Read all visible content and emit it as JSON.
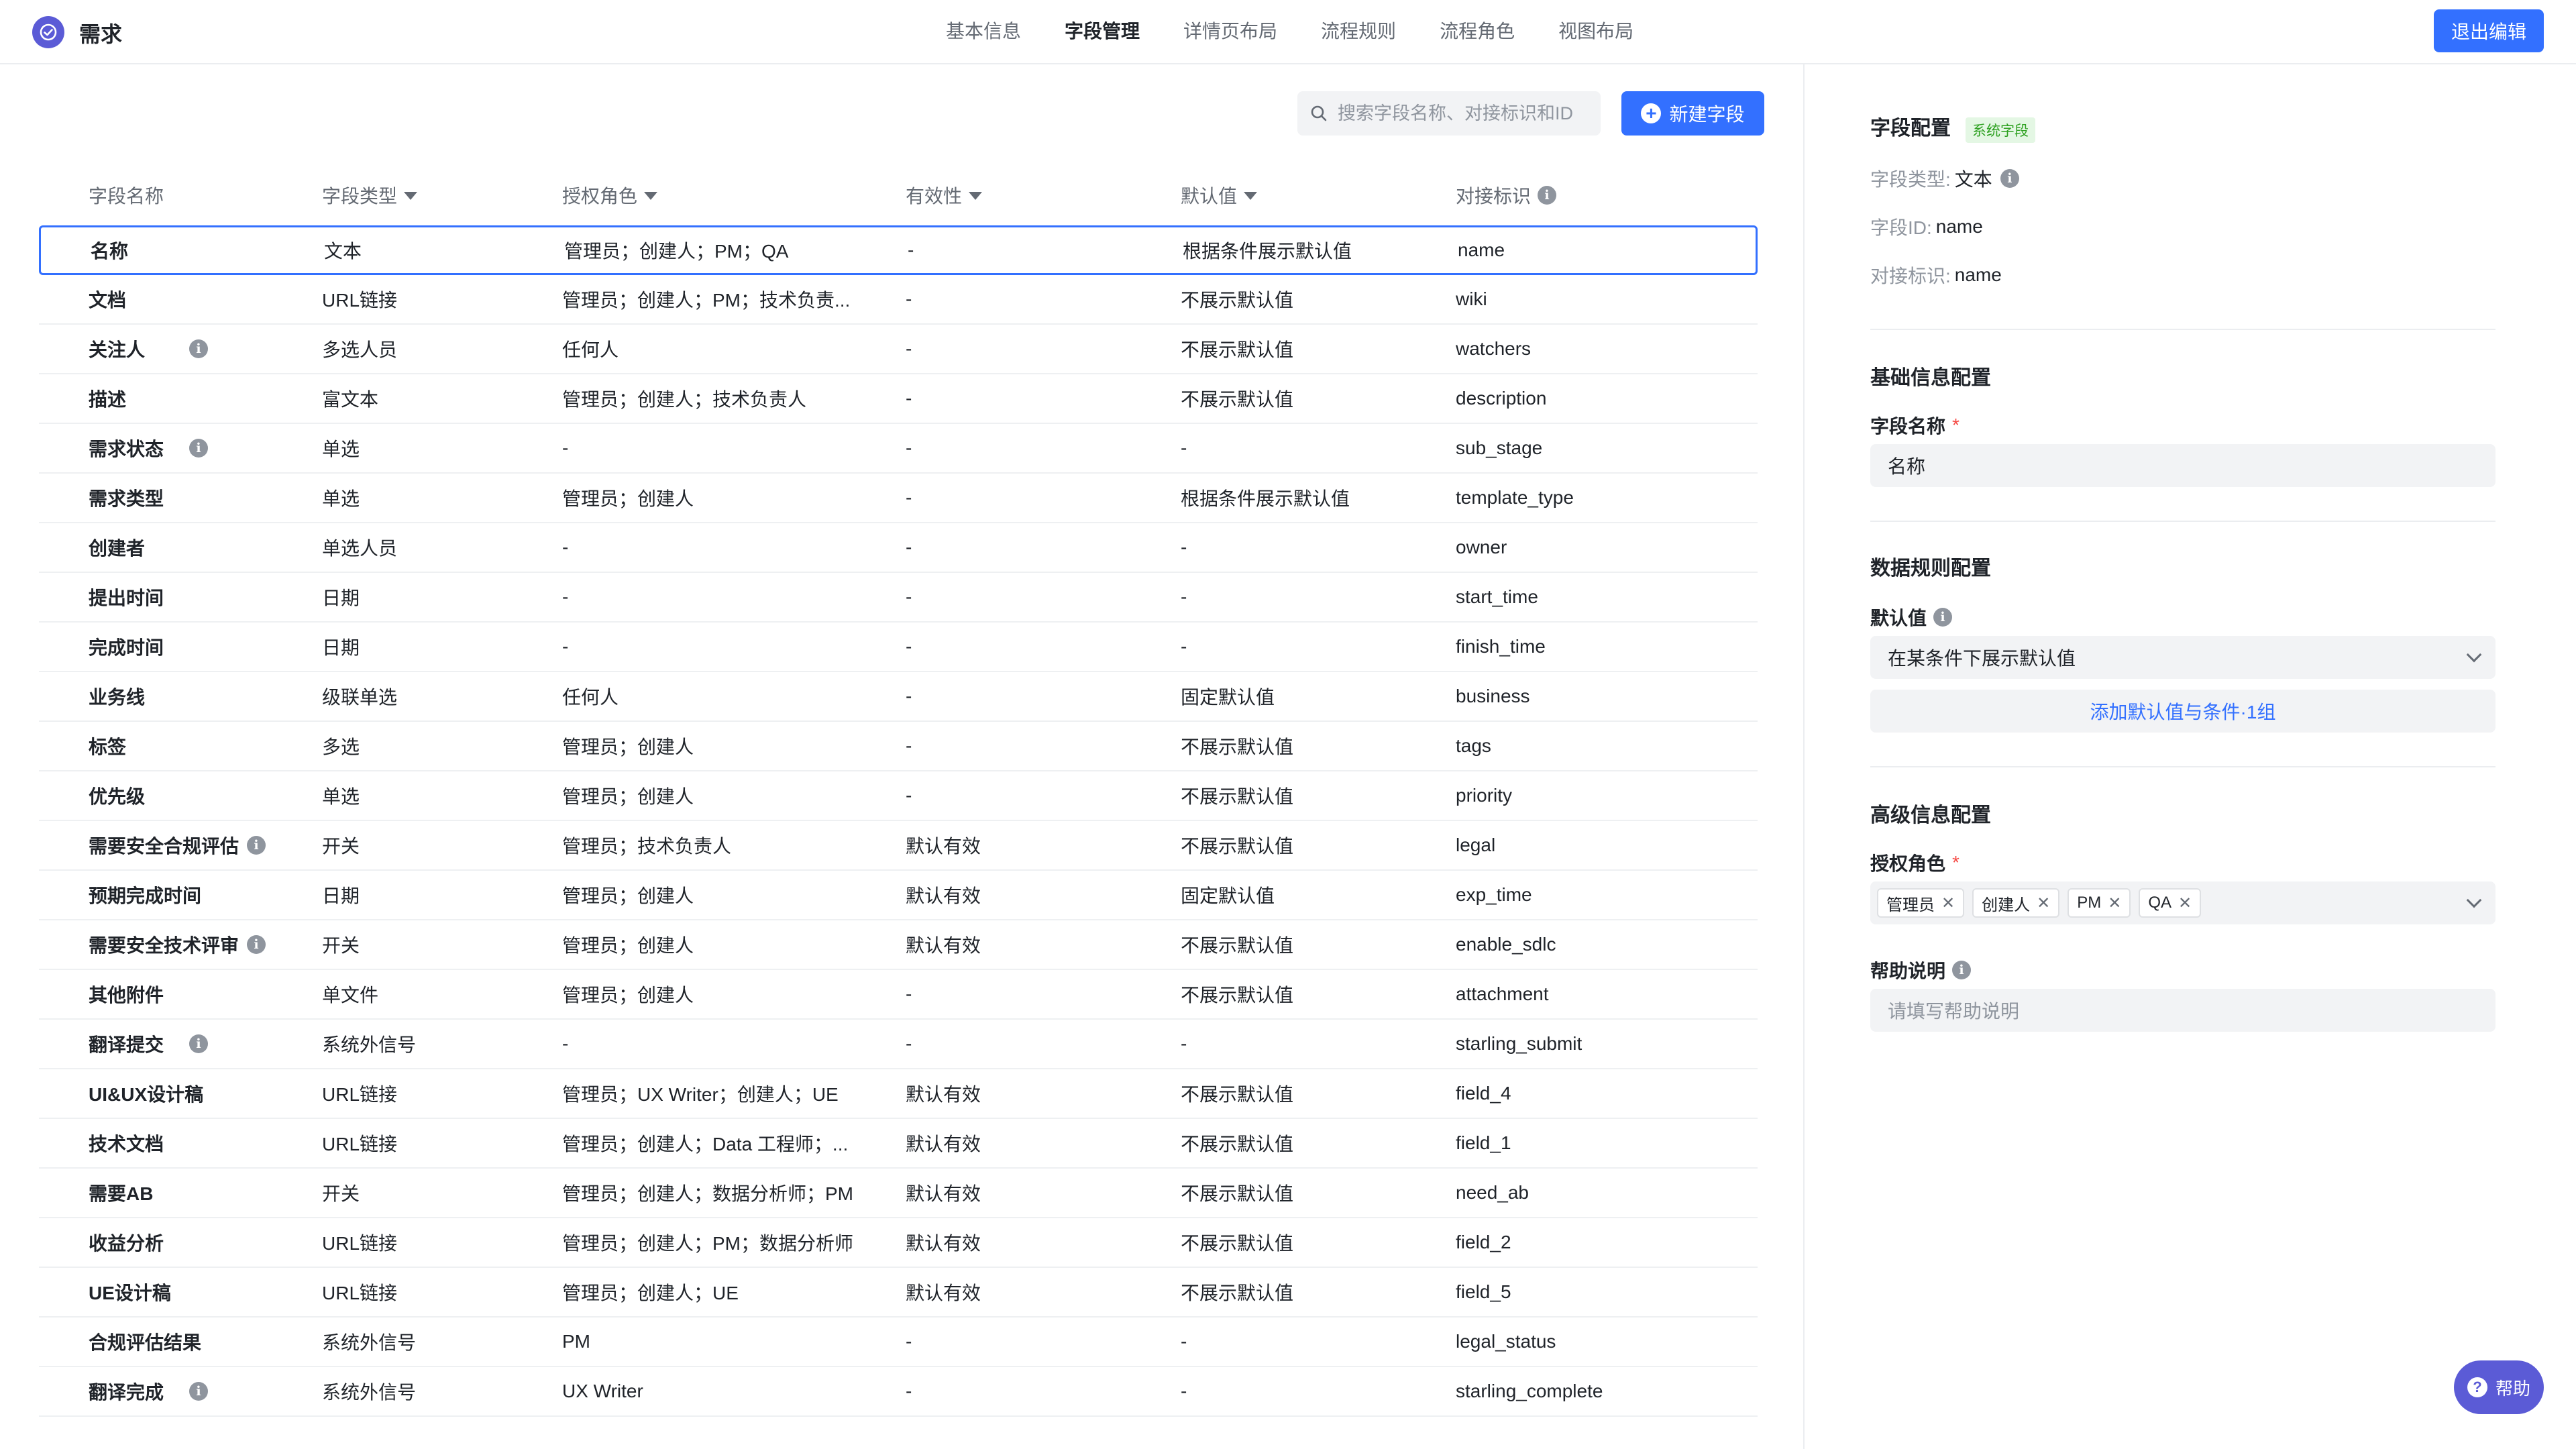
{
  "app": {
    "title": "需求"
  },
  "tabs": [
    "基本信息",
    "字段管理",
    "详情页布局",
    "流程规则",
    "流程角色",
    "视图布局"
  ],
  "header": {
    "exit_label": "退出编辑"
  },
  "toolbar": {
    "search_placeholder": "搜索字段名称、对接标识和ID",
    "new_field_label": "新建字段"
  },
  "table": {
    "columns": [
      "字段名称",
      "字段类型",
      "授权角色",
      "有效性",
      "默认值",
      "对接标识"
    ],
    "rows": [
      {
        "name": "名称",
        "type": "文本",
        "roles": "管理员；创建人；PM；QA",
        "validity": "-",
        "default": "根据条件展示默认值",
        "key": "name",
        "info": false
      },
      {
        "name": "文档",
        "type": "URL链接",
        "roles": "管理员；创建人；PM；技术负责...",
        "validity": "-",
        "default": "不展示默认值",
        "key": "wiki",
        "info": false
      },
      {
        "name": "关注人",
        "type": "多选人员",
        "roles": "任何人",
        "validity": "-",
        "default": "不展示默认值",
        "key": "watchers",
        "info": true
      },
      {
        "name": "描述",
        "type": "富文本",
        "roles": "管理员；创建人；技术负责人",
        "validity": "-",
        "default": "不展示默认值",
        "key": "description",
        "info": false
      },
      {
        "name": "需求状态",
        "type": "单选",
        "roles": "-",
        "validity": "-",
        "default": "-",
        "key": "sub_stage",
        "info": true
      },
      {
        "name": "需求类型",
        "type": "单选",
        "roles": "管理员；创建人",
        "validity": "-",
        "default": "根据条件展示默认值",
        "key": "template_type",
        "info": false
      },
      {
        "name": "创建者",
        "type": "单选人员",
        "roles": "-",
        "validity": "-",
        "default": "-",
        "key": "owner",
        "info": false
      },
      {
        "name": "提出时间",
        "type": "日期",
        "roles": "-",
        "validity": "-",
        "default": "-",
        "key": "start_time",
        "info": false
      },
      {
        "name": "完成时间",
        "type": "日期",
        "roles": "-",
        "validity": "-",
        "default": "-",
        "key": "finish_time",
        "info": false
      },
      {
        "name": "业务线",
        "type": "级联单选",
        "roles": "任何人",
        "validity": "-",
        "default": "固定默认值",
        "key": "business",
        "info": false
      },
      {
        "name": "标签",
        "type": "多选",
        "roles": "管理员；创建人",
        "validity": "-",
        "default": "不展示默认值",
        "key": "tags",
        "info": false
      },
      {
        "name": "优先级",
        "type": "单选",
        "roles": "管理员；创建人",
        "validity": "-",
        "default": "不展示默认值",
        "key": "priority",
        "info": false
      },
      {
        "name": "需要安全合规评估",
        "type": "开关",
        "roles": "管理员；技术负责人",
        "validity": "默认有效",
        "default": "不展示默认值",
        "key": "legal",
        "info": true
      },
      {
        "name": "预期完成时间",
        "type": "日期",
        "roles": "管理员；创建人",
        "validity": "默认有效",
        "default": "固定默认值",
        "key": "exp_time",
        "info": false
      },
      {
        "name": "需要安全技术评审",
        "type": "开关",
        "roles": "管理员；创建人",
        "validity": "默认有效",
        "default": "不展示默认值",
        "key": "enable_sdlc",
        "info": true
      },
      {
        "name": "其他附件",
        "type": "单文件",
        "roles": "管理员；创建人",
        "validity": "-",
        "default": "不展示默认值",
        "key": "attachment",
        "info": false
      },
      {
        "name": "翻译提交",
        "type": "系统外信号",
        "roles": "-",
        "validity": "-",
        "default": "-",
        "key": "starling_submit",
        "info": true
      },
      {
        "name": "UI&UX设计稿",
        "type": "URL链接",
        "roles": "管理员；UX Writer；创建人；UE",
        "validity": "默认有效",
        "default": "不展示默认值",
        "key": "field_4",
        "info": false
      },
      {
        "name": "技术文档",
        "type": "URL链接",
        "roles": "管理员；创建人；Data 工程师；...",
        "validity": "默认有效",
        "default": "不展示默认值",
        "key": "field_1",
        "info": false
      },
      {
        "name": "需要AB",
        "type": "开关",
        "roles": "管理员；创建人；数据分析师；PM",
        "validity": "默认有效",
        "default": "不展示默认值",
        "key": "need_ab",
        "info": false
      },
      {
        "name": "收益分析",
        "type": "URL链接",
        "roles": "管理员；创建人；PM；数据分析师",
        "validity": "默认有效",
        "default": "不展示默认值",
        "key": "field_2",
        "info": false
      },
      {
        "name": "UE设计稿",
        "type": "URL链接",
        "roles": "管理员；创建人；UE",
        "validity": "默认有效",
        "default": "不展示默认值",
        "key": "field_5",
        "info": false
      },
      {
        "name": "合规评估结果",
        "type": "系统外信号",
        "roles": "PM",
        "validity": "-",
        "default": "-",
        "key": "legal_status",
        "info": false
      },
      {
        "name": "翻译完成",
        "type": "系统外信号",
        "roles": "UX Writer",
        "validity": "-",
        "default": "-",
        "key": "starling_complete",
        "info": true
      }
    ]
  },
  "panel": {
    "title": "字段配置",
    "badge": "系统字段",
    "type_label": "字段类型:",
    "type_value": "文本",
    "id_label": "字段ID:",
    "id_value": "name",
    "key_label": "对接标识:",
    "key_value": "name",
    "basic_title": "基础信息配置",
    "name_label": "字段名称",
    "name_value": "名称",
    "data_title": "数据规则配置",
    "default_label": "默认值",
    "default_value": "在某条件下展示默认值",
    "add_condition": "添加默认值与条件·1组",
    "advanced_title": "高级信息配置",
    "roles_label": "授权角色",
    "roles": [
      "管理员",
      "创建人",
      "PM",
      "QA"
    ],
    "help_label": "帮助说明",
    "help_placeholder": "请填写帮助说明",
    "required_mark": "*"
  },
  "help_button": "帮助",
  "colors": {
    "accent": "#3370ff",
    "brand": "#5b5bd6"
  }
}
